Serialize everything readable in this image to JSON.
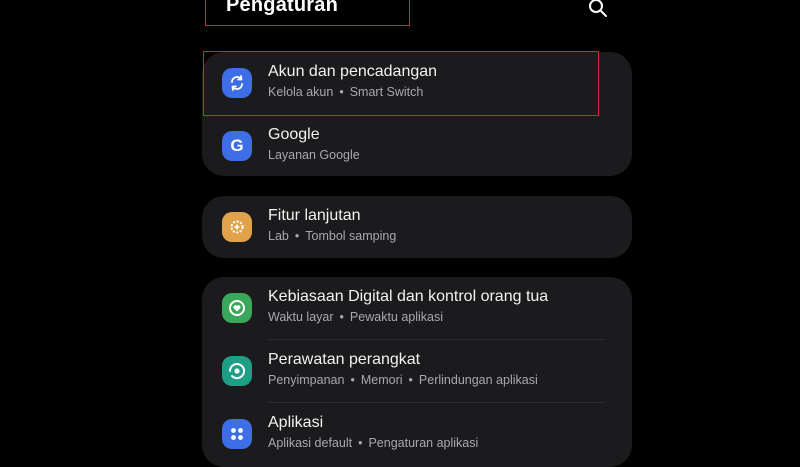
{
  "header": {
    "title": "Pengaturan",
    "search_icon": "search-icon"
  },
  "colors": {
    "background": "#000000",
    "card": "#1b1b1d",
    "highlight": "#d62828",
    "accounts_icon": "#3d6ee8",
    "google_icon": "#3d6ee8",
    "advanced_icon": "#e0a24a",
    "wellbeing_icon": "#3aa85a",
    "device_care_icon": "#1f9e86",
    "apps_icon": "#3d6ee8"
  },
  "items": [
    {
      "label": "Akun dan pencadangan",
      "subtitle": [
        "Kelola akun",
        "Smart Switch"
      ],
      "icon": "sync-icon"
    },
    {
      "label": "Google",
      "subtitle": [
        "Layanan Google"
      ],
      "icon": "google-icon"
    },
    {
      "label": "Fitur lanjutan",
      "subtitle": [
        "Lab",
        "Tombol samping"
      ],
      "icon": "gear-plus-icon"
    },
    {
      "label": "Kebiasaan Digital dan kontrol orang tua",
      "subtitle": [
        "Waktu layar",
        "Pewaktu aplikasi"
      ],
      "icon": "heart-circle-icon"
    },
    {
      "label": "Perawatan perangkat",
      "subtitle": [
        "Penyimpanan",
        "Memori",
        "Perlindungan aplikasi"
      ],
      "icon": "device-care-icon"
    },
    {
      "label": "Aplikasi",
      "subtitle": [
        "Aplikasi default",
        "Pengaturan aplikasi"
      ],
      "icon": "apps-grid-icon"
    }
  ]
}
